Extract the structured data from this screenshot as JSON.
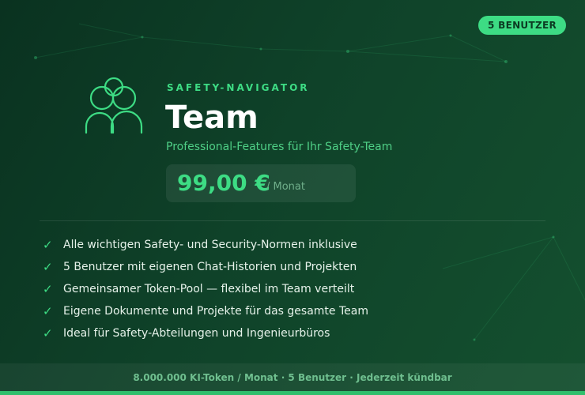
{
  "badge": "5 BENUTZER",
  "icon": "team-users-icon",
  "eyebrow": "SAFETY-NAVIGATOR",
  "title": "Team",
  "subtitle": "Professional-Features für Ihr Safety-Team",
  "price": {
    "amount": "99,00 €",
    "unit": "/ Monat"
  },
  "features": [
    "Alle wichtigen Safety- und Security-Normen inklusive",
    "5 Benutzer mit eigenen Chat-Historien und Projekten",
    "Gemeinsamer Token-Pool — flexibel im Team verteilt",
    "Eigene Dokumente und Projekte für das gesamte Team",
    "Ideal für Safety-Abteilungen und Ingenieurbüros"
  ],
  "check_glyph": "✓",
  "footer": "8.000.000 KI-Token / Monat · 5 Benutzer · Jederzeit kündbar",
  "colors": {
    "accent": "#3ddc84",
    "background": "#0f4229",
    "text": "#ffffff"
  }
}
